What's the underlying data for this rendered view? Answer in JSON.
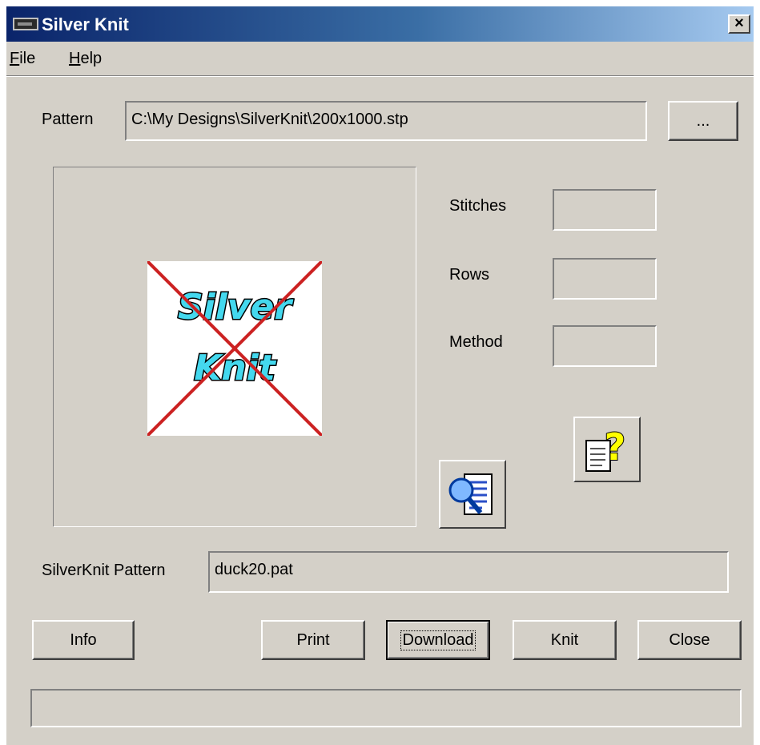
{
  "window": {
    "title": "Silver Knit",
    "close_glyph": "×"
  },
  "menu": {
    "file_first": "F",
    "file_rest": "ile",
    "help_first": "H",
    "help_rest": "elp"
  },
  "pattern": {
    "label": "Pattern",
    "value": "C:\\My Designs\\SilverKnit\\200x1000.stp",
    "browse_label": "..."
  },
  "preview": {
    "logo_line1": "Silver",
    "logo_line2": "Knit",
    "logo_colors": {
      "fill": "#44d8ee",
      "outline": "#000000",
      "cross": "#cc2222"
    }
  },
  "properties": {
    "stitches_label": "Stitches",
    "stitches_value": "",
    "rows_label": "Rows",
    "rows_value": "",
    "method_label": "Method",
    "method_value": ""
  },
  "icons": {
    "help_doc": "document-question-icon",
    "preview_doc": "document-magnifier-icon"
  },
  "silverknit_pattern": {
    "label": "SilverKnit Pattern",
    "value": "duck20.pat"
  },
  "buttons": {
    "info": "Info",
    "print": "Print",
    "download": "Download",
    "knit": "Knit",
    "close": "Close"
  },
  "status_bar": {
    "text": ""
  }
}
